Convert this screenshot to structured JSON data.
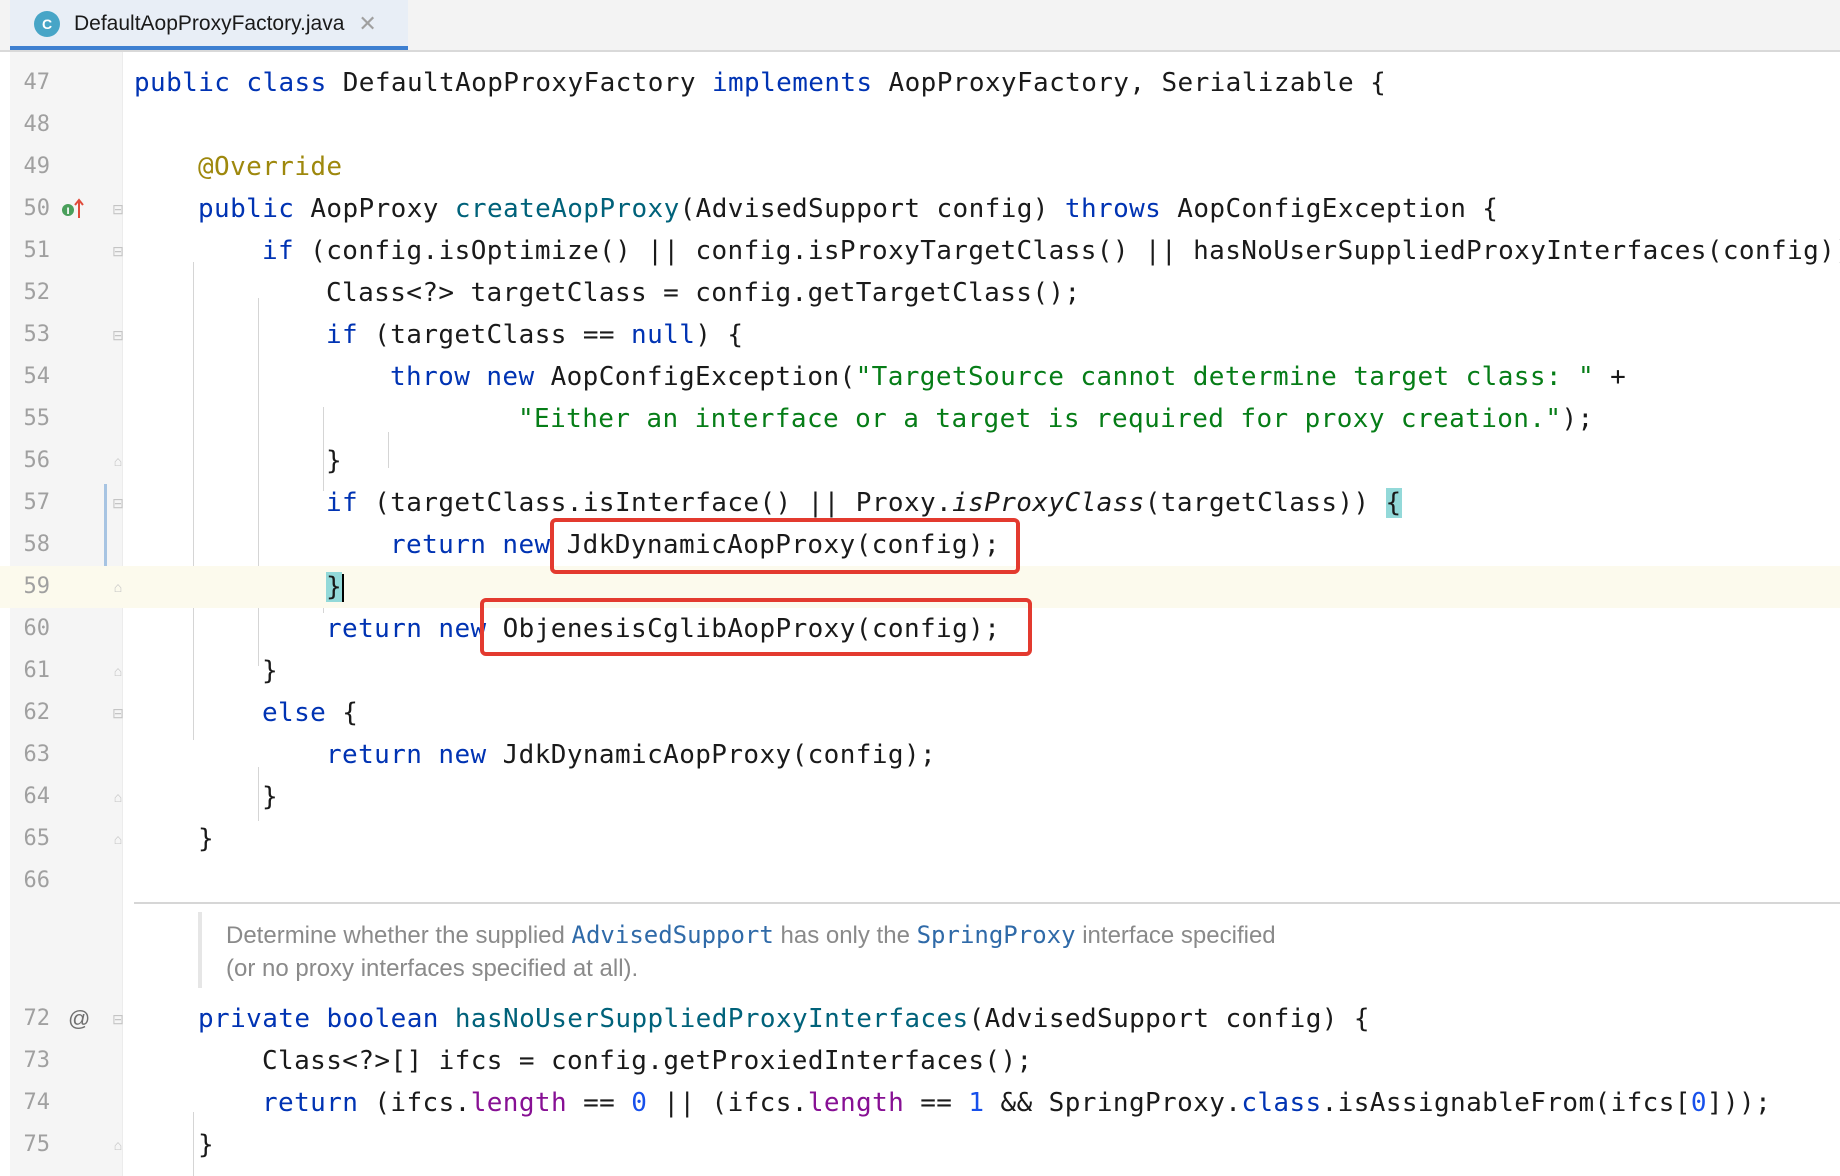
{
  "tab": {
    "icon_letter": "C",
    "filename": "DefaultAopProxyFactory.java",
    "close_glyph": "✕"
  },
  "markers": {
    "line50": "implements-method-icon",
    "line72": "@"
  },
  "lines": [
    {
      "num": "47"
    },
    {
      "num": "48"
    },
    {
      "num": "49"
    },
    {
      "num": "50"
    },
    {
      "num": "51"
    },
    {
      "num": "52"
    },
    {
      "num": "53"
    },
    {
      "num": "54"
    },
    {
      "num": "55"
    },
    {
      "num": "56"
    },
    {
      "num": "57"
    },
    {
      "num": "58"
    },
    {
      "num": "59"
    },
    {
      "num": "60"
    },
    {
      "num": "61"
    },
    {
      "num": "62"
    },
    {
      "num": "63"
    },
    {
      "num": "64"
    },
    {
      "num": "65"
    },
    {
      "num": "66"
    },
    {
      "num": "72"
    },
    {
      "num": "73"
    },
    {
      "num": "74"
    },
    {
      "num": "75"
    }
  ],
  "code": {
    "l47": {
      "t1": "public",
      "t2": " ",
      "t3": "class",
      "t4": " DefaultAopProxyFactory ",
      "t5": "implements",
      "t6": " AopProxyFactory, Serializable {"
    },
    "l49": {
      "t1": "@Override"
    },
    "l50": {
      "t1": "public",
      "t2": " AopProxy ",
      "t3": "createAopProxy",
      "t4": "(AdvisedSupport config) ",
      "t5": "throws",
      "t6": " AopConfigException {"
    },
    "l51": {
      "t1": "if",
      "t2": " (config.isOptimize() || config.isProxyTargetClass() || hasNoUserSuppliedProxyInterfaces(config))"
    },
    "l52": {
      "t1": "Class<?> targetClass = config.getTargetClass();"
    },
    "l53": {
      "t1": "if",
      "t2": " (targetClass == ",
      "t3": "null",
      "t4": ") {"
    },
    "l54": {
      "t1": "throw",
      "t2": " ",
      "t3": "new",
      "t4": " AopConfigException(",
      "t5": "\"TargetSource cannot determine target class: \"",
      "t6": " +"
    },
    "l55": {
      "t1": "\"Either an interface or a target is required for proxy creation.\"",
      "t2": ");"
    },
    "l56": {
      "t1": "}"
    },
    "l57": {
      "t1": "if",
      "t2": " (targetClass.isInterface() || Proxy.",
      "t3": "isProxyClass",
      "t4": "(targetClass)) ",
      "t5": "{"
    },
    "l58": {
      "t1": "return",
      "t2": " ",
      "t3": "new",
      "t4": " JdkDynamicAopProxy(config);"
    },
    "l59": {
      "t1": "}"
    },
    "l60": {
      "t1": "return",
      "t2": " ",
      "t3": "new",
      "t4": " ObjenesisCglibAopProxy(config);"
    },
    "l61": {
      "t1": "}"
    },
    "l62": {
      "t1": "else",
      "t2": " {"
    },
    "l63": {
      "t1": "return",
      "t2": " ",
      "t3": "new",
      "t4": " JdkDynamicAopProxy(config);"
    },
    "l64": {
      "t1": "}"
    },
    "l65": {
      "t1": "}"
    },
    "l72": {
      "t1": "private",
      "t2": " ",
      "t3": "boolean",
      "t4": " ",
      "t5": "hasNoUserSuppliedProxyInterfaces",
      "t6": "(AdvisedSupport config) {"
    },
    "l73": {
      "t1": "Class<?>[] ifcs = config.getProxiedInterfaces();"
    },
    "l74": {
      "t1": "return",
      "t2": " (ifcs.",
      "t3": "length",
      "t4": " == ",
      "t5": "0",
      "t6": " || (ifcs.",
      "t7": "length",
      "t8": " == ",
      "t9": "1",
      "t10": " && SpringProxy.",
      "t11": "class",
      "t12": ".isAssignableFrom(ifcs[",
      "t13": "0",
      "t14": "]));"
    },
    "l75": {
      "t1": "}"
    }
  },
  "doc": {
    "line1_a": "Determine whether the supplied ",
    "line1_link1": "AdvisedSupport",
    "line1_b": " has only the ",
    "line1_link2": "SpringProxy",
    "line1_c": " interface specified",
    "line2": "(or no proxy interfaces specified at all)."
  },
  "colors": {
    "keyword": "#0033b3",
    "string": "#067d17",
    "annotation": "#9e880d",
    "method_decl": "#00627a",
    "field": "#871094",
    "number": "#1750eb",
    "highlight_box": "#e33a2f",
    "current_line": "#fcfaed"
  }
}
